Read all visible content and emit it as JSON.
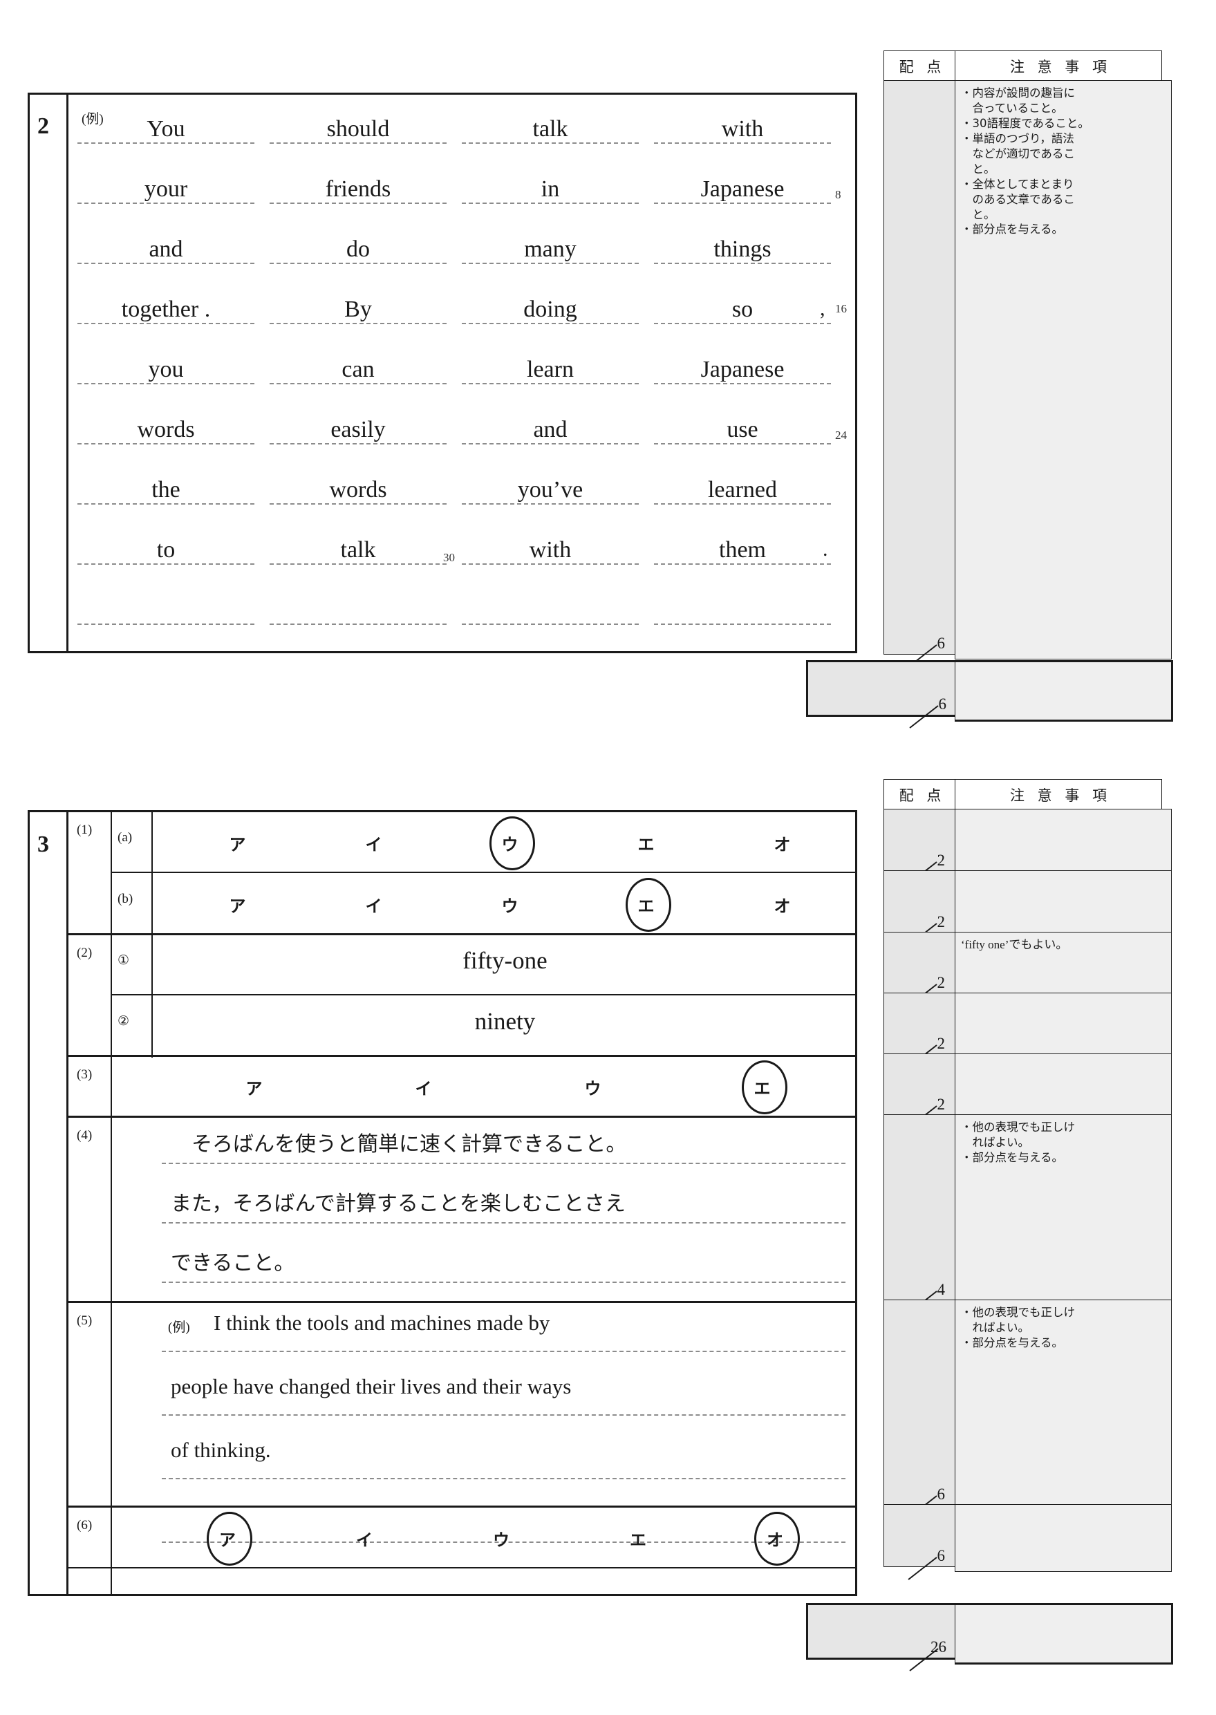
{
  "panel_headers": {
    "score": "配 点",
    "notes": "注 意 事 項"
  },
  "section2": {
    "number": "2",
    "example_label": "(例)",
    "rows": [
      [
        "You",
        "should",
        "talk",
        "with"
      ],
      [
        "your",
        "friends",
        "in",
        "Japanese"
      ],
      [
        "and",
        "do",
        "many",
        "things"
      ],
      [
        "together .",
        "By",
        "doing",
        "so"
      ],
      [
        "you",
        "can",
        "learn",
        "Japanese"
      ],
      [
        "words",
        "easily",
        "and",
        "use"
      ],
      [
        "the",
        "words",
        "you’ve",
        "learned"
      ],
      [
        "to",
        "talk",
        "with",
        "them"
      ],
      [
        "",
        "",
        "",
        ""
      ]
    ],
    "comma_after_so": ",",
    "period_after_them": ".",
    "word_markers": [
      "8",
      "16",
      "24",
      "30"
    ],
    "score": "6",
    "total_score": "6",
    "notes": [
      "・内容が設問の趣旨に",
      "　合っていること。",
      "・30語程度であること。",
      "・単語のつづり，語法",
      "　などが適切であるこ",
      "　と。",
      "・全体としてまとまり",
      "　のある文章であるこ",
      "　と。",
      "・部分点を与える。"
    ]
  },
  "section3": {
    "number": "3",
    "rows": {
      "r1a": {
        "label": "(1)",
        "sub": "(a)",
        "choices": [
          "ア",
          "イ",
          "ウ",
          "エ",
          "オ"
        ],
        "circled": [
          2
        ],
        "score": "2",
        "notes": []
      },
      "r1b": {
        "label": "",
        "sub": "(b)",
        "choices": [
          "ア",
          "イ",
          "ウ",
          "エ",
          "オ"
        ],
        "circled": [
          3
        ],
        "score": "2",
        "notes": []
      },
      "r2a": {
        "label": "(2)",
        "sub": "①",
        "answer": "fifty-one",
        "score": "2",
        "notes": [
          "‘fifty one’でもよい。"
        ]
      },
      "r2b": {
        "label": "",
        "sub": "②",
        "answer": "ninety",
        "score": "2",
        "notes": []
      },
      "r3": {
        "label": "(3)",
        "sub": "",
        "choices": [
          "ア",
          "イ",
          "ウ",
          "エ"
        ],
        "circled": [
          3
        ],
        "score": "2",
        "notes": []
      },
      "r4": {
        "label": "(4)",
        "sub": "",
        "lines": [
          "　そろばんを使うと簡単に速く計算できること。",
          "また，そろばんで計算することを楽しむことさえ",
          "できること。"
        ],
        "score": "4",
        "notes": [
          "・他の表現でも正しけ",
          "　ればよい。",
          "・部分点を与える。"
        ]
      },
      "r5": {
        "label": "(5)",
        "sub": "",
        "example_label": "(例)",
        "lines": [
          "I think the tools and machines made by",
          "people have changed their lives and their ways",
          "of thinking."
        ],
        "score": "6",
        "notes": [
          "・他の表現でも正しけ",
          "　ればよい。",
          "・部分点を与える。"
        ]
      },
      "r6": {
        "label": "(6)",
        "sub": "",
        "choices": [
          "ア",
          "イ",
          "ウ",
          "エ",
          "オ"
        ],
        "circled": [
          0,
          4
        ],
        "score": "6",
        "notes": []
      }
    },
    "total_score": "26"
  }
}
